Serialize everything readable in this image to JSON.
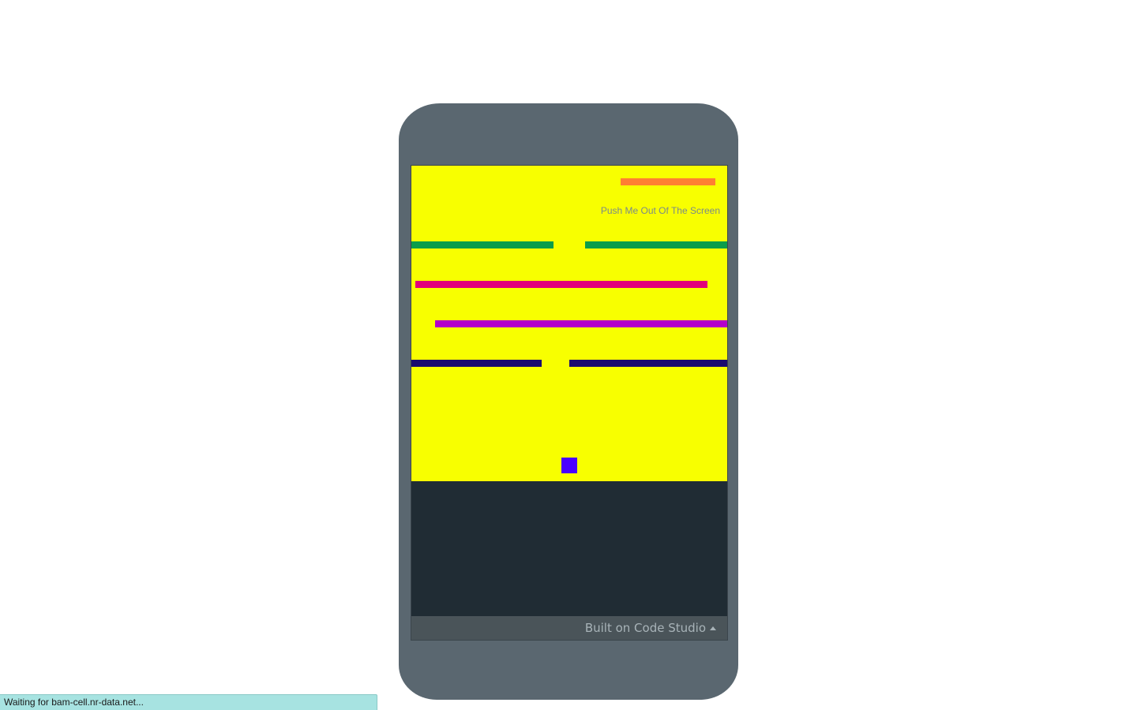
{
  "game": {
    "background_color": "#f8ff00",
    "text": "Push Me Out Of The Screen",
    "text_color": "#7a8a8a",
    "top_paddle": {
      "name": "orange-paddle",
      "color": "#ff7f32"
    },
    "rows": [
      {
        "name": "green",
        "color": "#0b9d4a",
        "segments": 2
      },
      {
        "name": "pink",
        "color": "#e2007a",
        "segments": 1
      },
      {
        "name": "purple",
        "color": "#b400c8",
        "segments": 1
      },
      {
        "name": "navy",
        "color": "#1a0a6e",
        "segments": 2
      }
    ],
    "player": {
      "color": "#4a00ff",
      "icon": "square-block"
    }
  },
  "footer": {
    "label": "Built on Code Studio",
    "icon": "caret-up-icon"
  },
  "status": {
    "text": "Waiting for bam-cell.nr-data.net..."
  }
}
